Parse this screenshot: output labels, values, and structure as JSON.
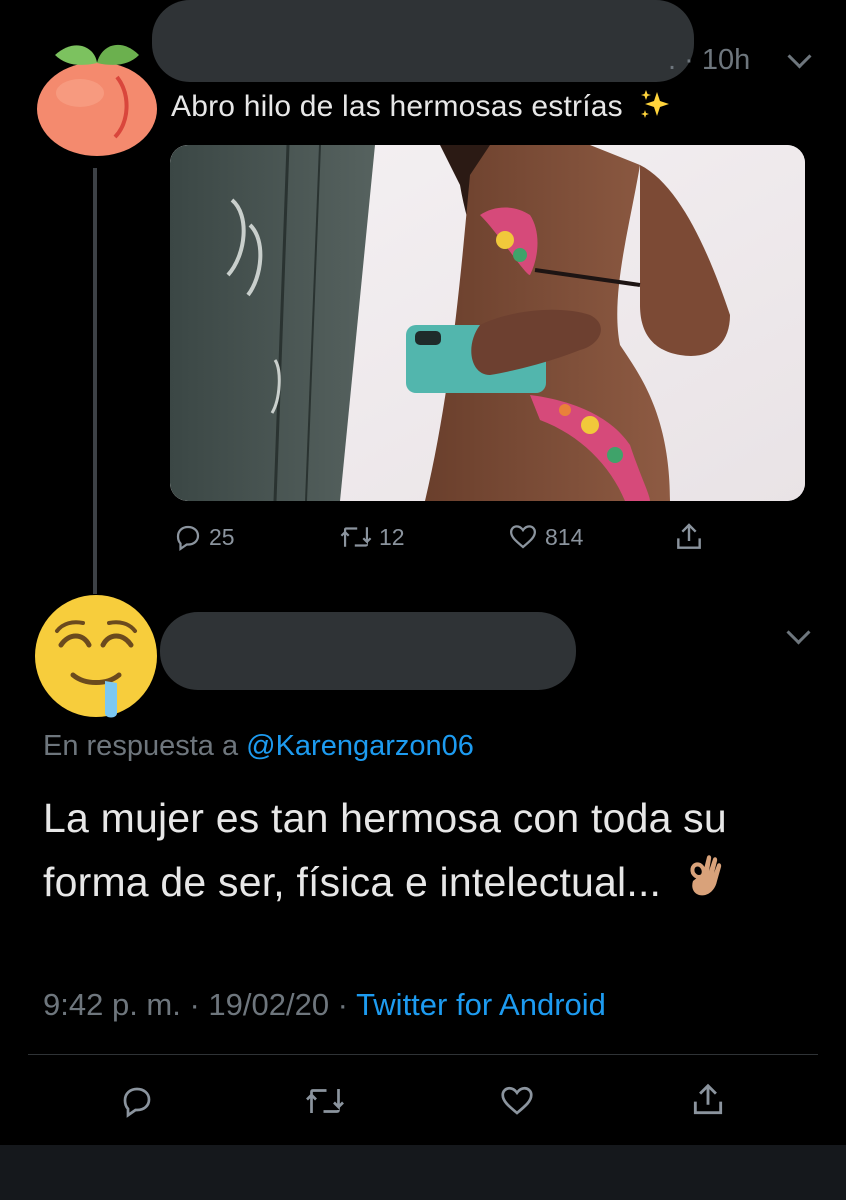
{
  "tweet1": {
    "time": ". · 10h",
    "text": "Abro hilo de las hermosas estrías",
    "stats": {
      "replies": "25",
      "retweets": "12",
      "likes": "814"
    }
  },
  "tweet2": {
    "reply_prefix": "En respuesta a",
    "reply_handle": "@Karengarzon06",
    "text": "La mujer es tan hermosa con toda su forma de ser, física e intelectual...",
    "timestamp": "9:42 p. m. · 19/02/20 · ",
    "source": "Twitter for Android"
  },
  "icons": {
    "avatar1": "peach-emoji-avatar",
    "avatar2": "drooling-face-emoji-avatar",
    "reply": "reply-icon",
    "retweet": "retweet-icon",
    "like": "like-icon",
    "share": "share-icon",
    "more": "chevron-down-icon"
  },
  "colors": {
    "background": "#000000",
    "accent": "#1d9bf0",
    "muted": "#6e767d",
    "redaction": "#2f3336"
  }
}
